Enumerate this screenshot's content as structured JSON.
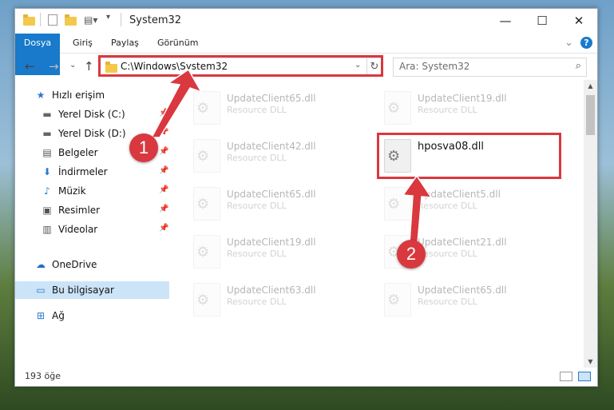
{
  "window": {
    "title": "System32",
    "controls": {
      "minimize": "—",
      "maximize": "☐",
      "close": "✕"
    }
  },
  "ribbon": {
    "tabs": [
      "Dosya",
      "Giriş",
      "Paylaş",
      "Görünüm"
    ],
    "help": "?",
    "expand": "⌄"
  },
  "address": {
    "path": "C:\\Windows\\System32",
    "refresh": "↻",
    "dropdown": "⌄"
  },
  "search": {
    "placeholder": "Ara: System32",
    "icon": "⌕"
  },
  "nav": {
    "back": "←",
    "forward": "→",
    "recent": "⌄",
    "up": "↑"
  },
  "sidebar": {
    "items": [
      {
        "label": "Hızlı erişim",
        "icon": "★",
        "pin": false
      },
      {
        "label": "Yerel Disk (C:)",
        "icon": "▬",
        "pin": true
      },
      {
        "label": "Yerel Disk (D:)",
        "icon": "▬",
        "pin": true
      },
      {
        "label": "Belgeler",
        "icon": "▤",
        "pin": true
      },
      {
        "label": "İndirmeler",
        "icon": "⬇",
        "pin": true
      },
      {
        "label": "Müzik",
        "icon": "♪",
        "pin": true
      },
      {
        "label": "Resimler",
        "icon": "▣",
        "pin": true
      },
      {
        "label": "Videolar",
        "icon": "▥",
        "pin": true
      },
      {
        "label": "OneDrive",
        "icon": "☁",
        "pin": false
      },
      {
        "label": "Bu bilgisayar",
        "icon": "▭",
        "pin": false
      },
      {
        "label": "Ağ",
        "icon": "⊞",
        "pin": false
      }
    ],
    "pin_glyph": "📌"
  },
  "files": {
    "left": [
      {
        "name": "UpdateClient65.dll",
        "type": "Resource DLL"
      },
      {
        "name": "UpdateClient42.dll",
        "type": "Resource DLL"
      },
      {
        "name": "UpdateClient65.dll",
        "type": "Resource DLL"
      },
      {
        "name": "UpdateClient19.dll",
        "type": "Resource DLL"
      },
      {
        "name": "UpdateClient63.dll",
        "type": "Resource DLL"
      }
    ],
    "right": [
      {
        "name": "UpdateClient19.dll",
        "type": "Resource DLL"
      },
      {
        "name": "hposva08.dll",
        "type": ""
      },
      {
        "name": "UpdateClient5.dll",
        "type": "Resource DLL"
      },
      {
        "name": "UpdateClient21.dll",
        "type": "Resource DLL"
      },
      {
        "name": "UpdateClient65.dll",
        "type": "Resource DLL"
      }
    ]
  },
  "status": {
    "count": "193 öğe"
  },
  "annotations": {
    "badge1": "1",
    "badge2": "2",
    "accent": "#d9383f"
  }
}
